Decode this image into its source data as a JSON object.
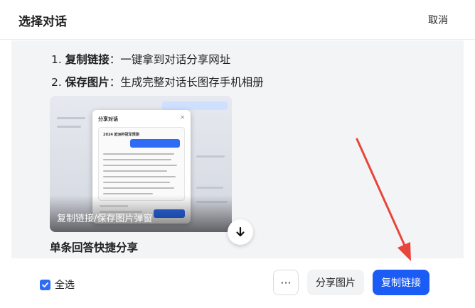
{
  "header": {
    "title": "选择对话",
    "cancel_label": "取消"
  },
  "steps": [
    {
      "num": "1. ",
      "bold": "复制链接",
      "rest": "：一键拿到对话分享网址"
    },
    {
      "num": "2. ",
      "bold": "保存图片",
      "rest": "：生成完整对话长图存手机相册"
    }
  ],
  "preview": {
    "caption": "复制链接/保存图片弹窗",
    "modal_title": "分享对话",
    "card_title": "2024 欧洲杯冠军预测"
  },
  "section": {
    "title": "单条回答快捷分享"
  },
  "footer": {
    "select_all_label": "全选",
    "select_all_checked": true,
    "more_label": "···",
    "share_image_label": "分享图片",
    "copy_link_label": "复制链接"
  },
  "colors": {
    "accent": "#1a5cf4",
    "annotation_arrow": "#e8453c"
  },
  "icons": {
    "checkbox": "check-icon",
    "scroll": "arrow-down-icon",
    "modal_close": "close-icon"
  }
}
